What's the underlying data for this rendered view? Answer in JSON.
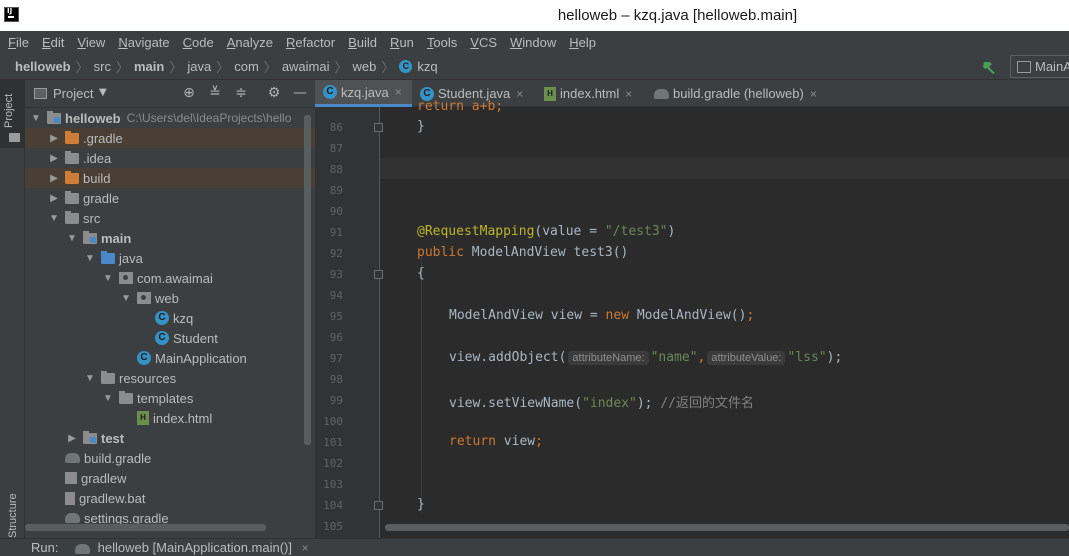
{
  "window": {
    "title": "helloweb – kzq.java [helloweb.main]"
  },
  "menu": [
    "File",
    "Edit",
    "View",
    "Navigate",
    "Code",
    "Analyze",
    "Refactor",
    "Build",
    "Run",
    "Tools",
    "VCS",
    "Window",
    "Help"
  ],
  "breadcrumb": [
    "helloweb",
    "src",
    "main",
    "java",
    "com",
    "awaimai",
    "web",
    "kzq"
  ],
  "run_config": "MainA",
  "left_strip": {
    "project_label": "Project",
    "structure_label": "Structure"
  },
  "project_panel": {
    "title": "Project",
    "tree": [
      {
        "label": "helloweb",
        "hint": "C:\\Users\\del\\IdeaProjects\\hello",
        "icon": "module-folder-icon"
      },
      {
        "label": ".gradle",
        "icon": "folder-icon"
      },
      {
        "label": ".idea",
        "icon": "folder-icon"
      },
      {
        "label": "build",
        "icon": "folder-icon"
      },
      {
        "label": "gradle",
        "icon": "folder-icon"
      },
      {
        "label": "src",
        "icon": "folder-icon"
      },
      {
        "label": "main",
        "icon": "module-folder-icon"
      },
      {
        "label": "java",
        "icon": "source-folder-icon"
      },
      {
        "label": "com.awaimai",
        "icon": "package-icon"
      },
      {
        "label": "web",
        "icon": "package-icon"
      },
      {
        "label": "kzq",
        "icon": "java-class-icon"
      },
      {
        "label": "Student",
        "icon": "java-class-icon"
      },
      {
        "label": "MainApplication",
        "icon": "spring-class-icon"
      },
      {
        "label": "resources",
        "icon": "resources-folder-icon"
      },
      {
        "label": "templates",
        "icon": "folder-icon"
      },
      {
        "label": "index.html",
        "icon": "html-file-icon"
      },
      {
        "label": "test",
        "icon": "module-folder-icon"
      },
      {
        "label": "build.gradle",
        "icon": "gradle-icon"
      },
      {
        "label": "gradlew",
        "icon": "terminal-file-icon"
      },
      {
        "label": "gradlew.bat",
        "icon": "bat-file-icon"
      },
      {
        "label": "settings.gradle",
        "icon": "gradle-icon"
      }
    ]
  },
  "tabs": [
    {
      "label": "kzq.java",
      "close": "×"
    },
    {
      "label": "Student.java",
      "close": "×"
    },
    {
      "label": "index.html",
      "close": "×"
    },
    {
      "label": "build.gradle (helloweb)",
      "close": "×"
    }
  ],
  "editor": {
    "line_numbers": [
      "86",
      "87",
      "88",
      "89",
      "90",
      "91",
      "92",
      "93",
      "94",
      "95",
      "96",
      "97",
      "98",
      "99",
      "100",
      "101",
      "102",
      "103",
      "104",
      "105"
    ],
    "partial_top": "return a+b;",
    "lines": {
      "l86": "}",
      "l91_annot": "@RequestMapping",
      "l91_rest": "(value = ",
      "l91_str": "\"/test3\"",
      "l91_end": ")",
      "l92_kw": "public",
      "l92_type": " ModelAndView ",
      "l92_fn": "test3",
      "l92_end": "()",
      "l93": "{",
      "l95_a": "ModelAndView view = ",
      "l95_kw": "new",
      "l95_b": " ModelAndView()",
      "l95_semi": ";",
      "l97_a": "view.addObject(",
      "l97_hint1": "attributeName:",
      "l97_str1": "\"name\"",
      "l97_comma": ",",
      "l97_hint2": "attributeValue:",
      "l97_str2": "\"lss\"",
      "l97_end": ");",
      "l99_a": "view.setViewName(",
      "l99_str": "\"index\"",
      "l99_b": "); ",
      "l99_cmt": "//返回的文件名",
      "l101_kw": "return",
      "l101_rest": " view",
      "l101_semi": ";",
      "l104": "}"
    }
  },
  "run_bar": {
    "label": "Run:",
    "tab": "helloweb [MainApplication.main()]",
    "close": "×"
  },
  "colors": {
    "background": "#2b2b2b",
    "panel": "#3c3f41",
    "accent": "#4a88c7",
    "keyword": "#cc7832",
    "string": "#6a8759",
    "annotation": "#bbb529"
  }
}
